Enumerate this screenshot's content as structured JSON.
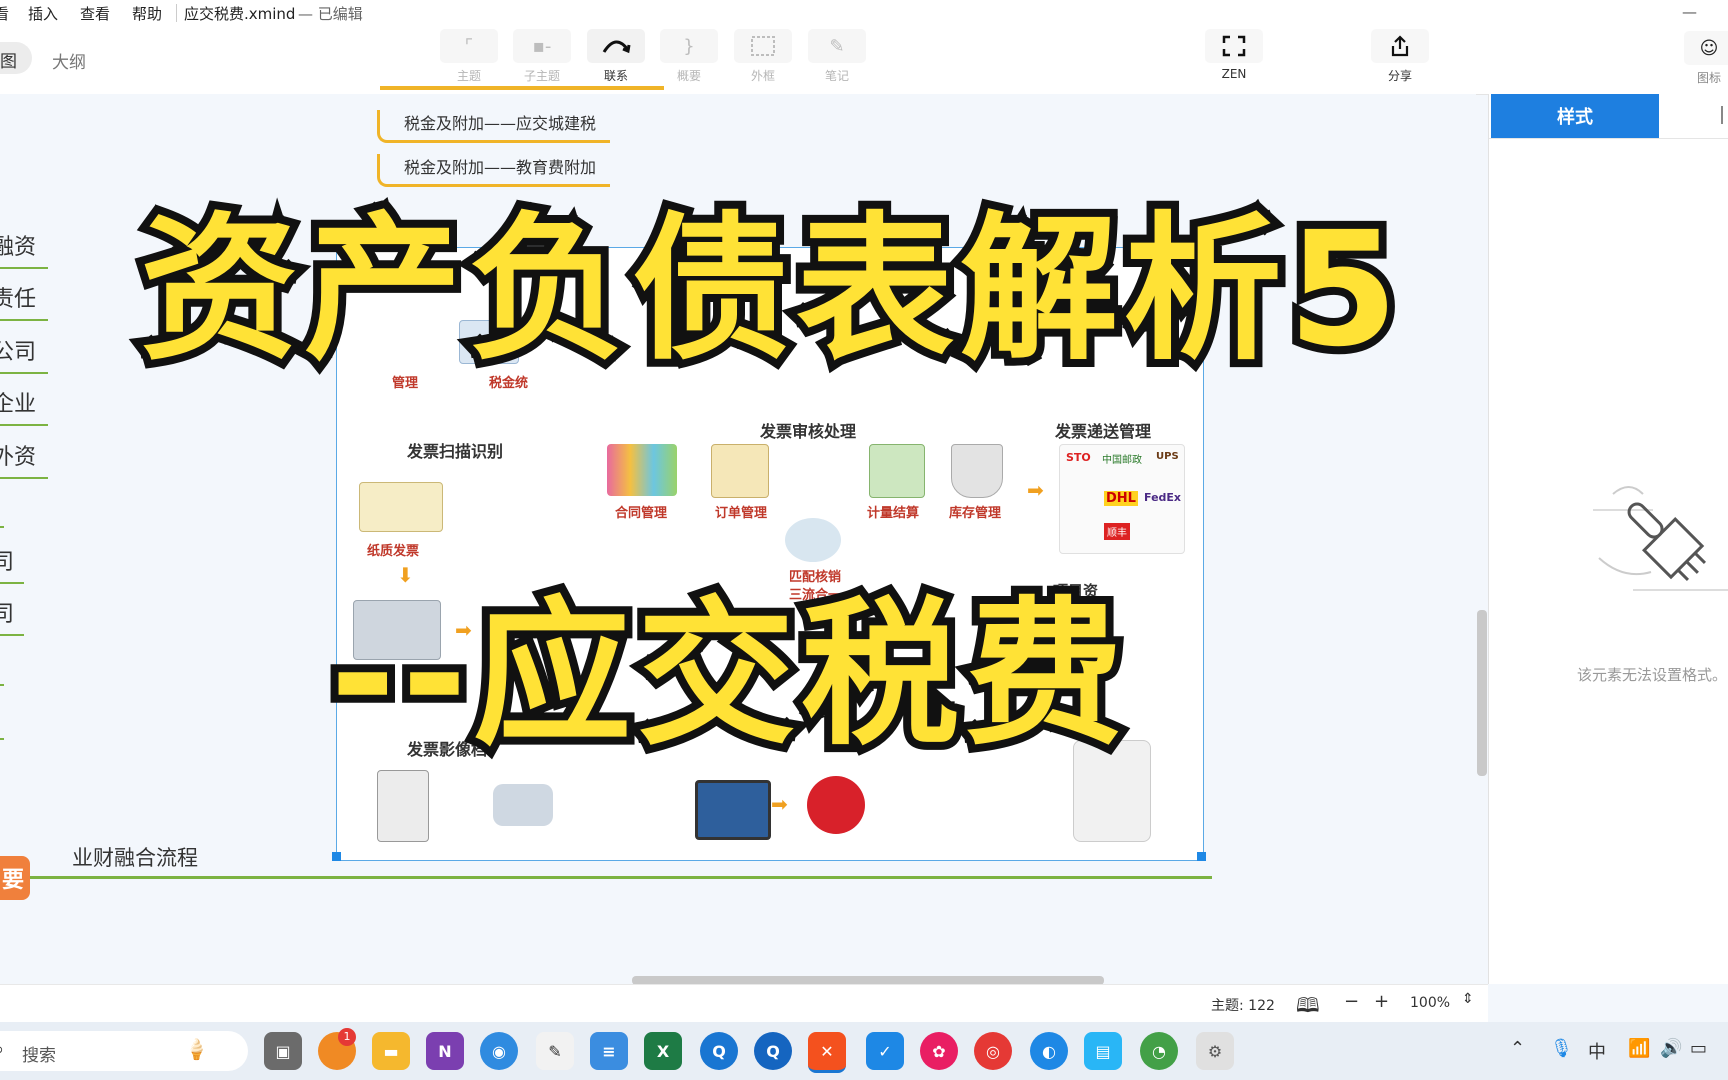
{
  "menubar": {
    "items": [
      "看",
      "插入",
      "查看",
      "帮助"
    ],
    "file_title": "应交税费.xmind",
    "file_status": "— 已编辑",
    "minimize": "—"
  },
  "toolbar": {
    "view_tabs": [
      "图",
      "大纲"
    ],
    "buttons": [
      {
        "label": "主题",
        "icon": "topic-icon"
      },
      {
        "label": "子主题",
        "icon": "subtopic-icon"
      },
      {
        "label": "联系",
        "icon": "relationship-icon"
      },
      {
        "label": "概要",
        "icon": "summary-icon"
      },
      {
        "label": "外框",
        "icon": "boundary-icon"
      },
      {
        "label": "笔记",
        "icon": "note-icon"
      }
    ],
    "zen_label": "ZEN",
    "share_label": "分享",
    "icon_label": "图标"
  },
  "mindmap": {
    "branches": [
      "税金及附加——应交城建税",
      "税金及附加——教育费附加"
    ],
    "side_items": [
      "融资",
      "责任",
      "公司",
      "企业",
      "外资",
      "司",
      "司"
    ],
    "bottom_topic": "业财融合流程",
    "root_fragment": "要"
  },
  "flowchart": {
    "sections": [
      "发票扫描识别",
      "发票审核处理",
      "发票递送管理",
      "发票影像档",
      "项目资"
    ],
    "labels": [
      "管理",
      "税金统",
      "纸质发票",
      "合同管理",
      "订单管理",
      "计量结算",
      "库存管理",
      "匹配核销",
      "三流合一"
    ],
    "carriers": [
      "STO",
      "中国邮政",
      "UPS",
      "DHL",
      "FedEx",
      "顺丰"
    ]
  },
  "overlay": {
    "line1": "资产负债表解析5",
    "line2": "--应交税费"
  },
  "rightpanel": {
    "tab_active": "样式",
    "message": "该元素无法设置格式。"
  },
  "statusbar": {
    "topic_count": "主题: 122",
    "zoom": "100%",
    "minus": "−",
    "plus": "+"
  },
  "taskbar": {
    "search_placeholder": "搜索",
    "badge": "1",
    "ime": "中"
  },
  "colors": {
    "accent_blue": "#1e7fe0",
    "branch_yellow": "#f0b428",
    "side_green": "#7cb342",
    "title_yellow": "#ffe236",
    "root_orange": "#f0803c"
  }
}
